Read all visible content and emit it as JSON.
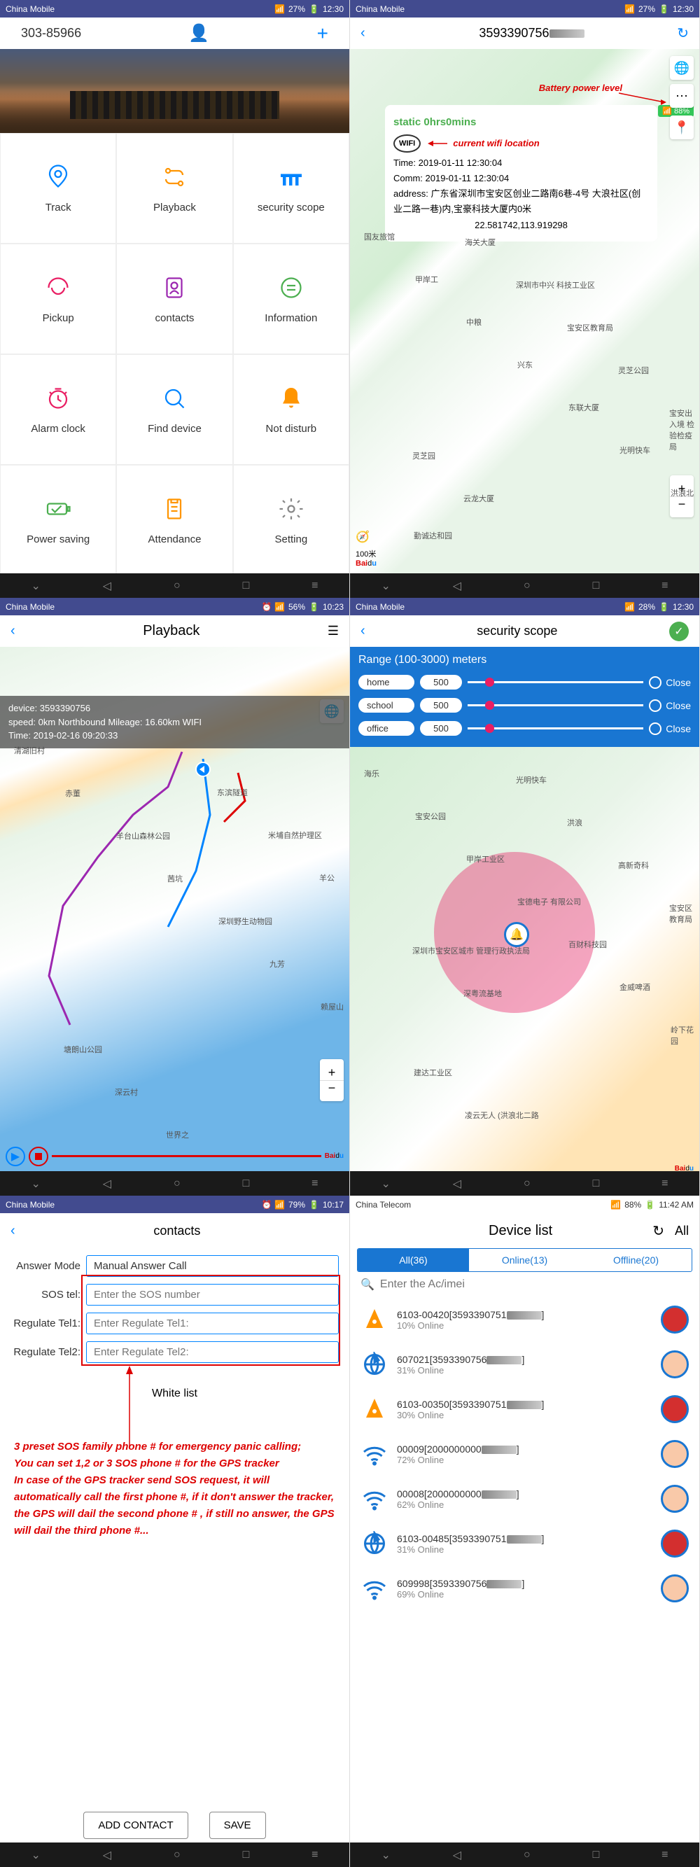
{
  "status": {
    "carrier1": "China Mobile",
    "carrier2": "China Telecom",
    "battery1": "27%",
    "time1": "12:30",
    "battery3": "56%",
    "time3": "10:23",
    "battery4": "28%",
    "time4": "12:30",
    "battery5": "79%",
    "time5": "10:17",
    "battery6": "88%",
    "time6": "11:42 AM"
  },
  "screen1": {
    "title": "303-85966",
    "menu": [
      {
        "label": "Track",
        "color": "#0084ff"
      },
      {
        "label": "Playback",
        "color": "#ff9500"
      },
      {
        "label": "security scope",
        "color": "#0084ff"
      },
      {
        "label": "Pickup",
        "color": "#e91e63"
      },
      {
        "label": "contacts",
        "color": "#9c27b0"
      },
      {
        "label": "Information",
        "color": "#4caf50"
      },
      {
        "label": "Alarm clock",
        "color": "#e91e63"
      },
      {
        "label": "Find device",
        "color": "#0084ff"
      },
      {
        "label": "Not disturb",
        "color": "#ff9500"
      },
      {
        "label": "Power saving",
        "color": "#4caf50"
      },
      {
        "label": "Attendance",
        "color": "#ff9500"
      },
      {
        "label": "Setting",
        "color": "#888"
      }
    ]
  },
  "screen2": {
    "title": "3593390756",
    "ann_battery": "Battery power level",
    "status_text": "static 0hrs0mins",
    "wifi_label": "WIFI",
    "ann_wifi": "current wifi location",
    "time_label": "Time: 2019-01-11 12:30:04",
    "comm_label": "Comm: 2019-01-11 12:30:04",
    "address_label": "address: 广东省深圳市宝安区创业二路南6巷-4号 大浪社区(创业二路一巷)内,宝豪科技大厦内0米",
    "coords": "22.581742,113.919298",
    "battery_pct": "88%",
    "scale": "100米",
    "map_labels": [
      "国友旅馆",
      "甲岸工",
      "中粮",
      "兴东",
      "东联大厦",
      "光明快车",
      "洪浪北",
      "勤诚达和园",
      "海关大厦",
      "深圳市中兴 科技工业区",
      "宝安区教育局",
      "灵芝公园",
      "宝安出入境 检验检疫局",
      "灵芝园",
      "云龙大厦"
    ]
  },
  "screen3": {
    "title": "Playback",
    "device": "device: 3593390756",
    "speed": "speed:  0km Northbound Mileage:    16.60km WIFI",
    "time": "Time:  2019-02-16 09:20:33",
    "map_labels": [
      "清湖旧村",
      "赤董",
      "羊台山森林公园",
      "茜坑",
      "深圳野生动物园",
      "九芳",
      "赖屋山",
      "塘朗山公园",
      "深云村",
      "世界之",
      "东滨隧道",
      "米埔自然护理区",
      "羊公"
    ]
  },
  "screen4": {
    "title": "security scope",
    "range_label": "Range (100-3000) meters",
    "rows": [
      {
        "name": "home",
        "val": "500",
        "close": "Close"
      },
      {
        "name": "school",
        "val": "500",
        "close": "Close"
      },
      {
        "name": "office",
        "val": "500",
        "close": "Close"
      }
    ],
    "map_labels": [
      "海乐",
      "宝安公园",
      "甲岸工业区",
      "宝德电子 有限公司",
      "百财科技园",
      "金威啤酒",
      "岭下花园",
      "建达工业区",
      "凌云无人 (洪浪北二路",
      "光明快车",
      "洪浪",
      "高新奇科",
      "宝安区教育局",
      "深圳市宝安区城市 管理行政执法局",
      "深粤流基地"
    ]
  },
  "screen5": {
    "title": "contacts",
    "answer_label": "Answer Mode",
    "answer_value": "Manual Answer Call",
    "sos_label": "SOS tel:",
    "sos_placeholder": "Enter the SOS number",
    "reg1_label": "Regulate Tel1:",
    "reg1_placeholder": "Enter Regulate Tel1:",
    "reg2_label": "Regulate Tel2:",
    "reg2_placeholder": "Enter Regulate Tel2:",
    "whitelist": "White list",
    "note1": "3 preset SOS family phone # for emergency panic calling;",
    "note2": "You can set 1,2 or 3 SOS phone # for the GPS tracker",
    "note3": "In case of the GPS tracker send SOS request, it will automatically call the first phone #, if it don't answer the tracker, the GPS will dail the second phone # , if still no answer, the GPS will dail the third phone #...",
    "btn_add": "ADD CONTACT",
    "btn_save": "SAVE"
  },
  "screen6": {
    "title": "Device list",
    "all_label": "All",
    "tabs": [
      {
        "label": "All(36)",
        "active": true
      },
      {
        "label": "Online(13)",
        "active": false
      },
      {
        "label": "Offline(20)",
        "active": false
      }
    ],
    "search_placeholder": "Enter the Ac/imei",
    "devices": [
      {
        "name": "6103-00420[3593390751",
        "status": "10%  Online",
        "icon": "gps",
        "avatar": "#d32f2f"
      },
      {
        "name": "607021[3593390756",
        "status": "31%  Online",
        "icon": "globe",
        "avatar": "#f9c9a9"
      },
      {
        "name": "6103-00350[3593390751",
        "status": "30%  Online",
        "icon": "gps",
        "avatar": "#d32f2f"
      },
      {
        "name": "00009[2000000000",
        "status": "72%  Online",
        "icon": "wifi",
        "avatar": "#f9c9a9"
      },
      {
        "name": "00008[2000000000",
        "status": "62%  Online",
        "icon": "wifi",
        "avatar": "#f9c9a9"
      },
      {
        "name": "6103-00485[3593390751",
        "status": "31%  Online",
        "icon": "globe",
        "avatar": "#d32f2f"
      },
      {
        "name": "609998[3593390756",
        "status": "69%  Online",
        "icon": "wifi",
        "avatar": "#f9c9a9"
      }
    ]
  }
}
